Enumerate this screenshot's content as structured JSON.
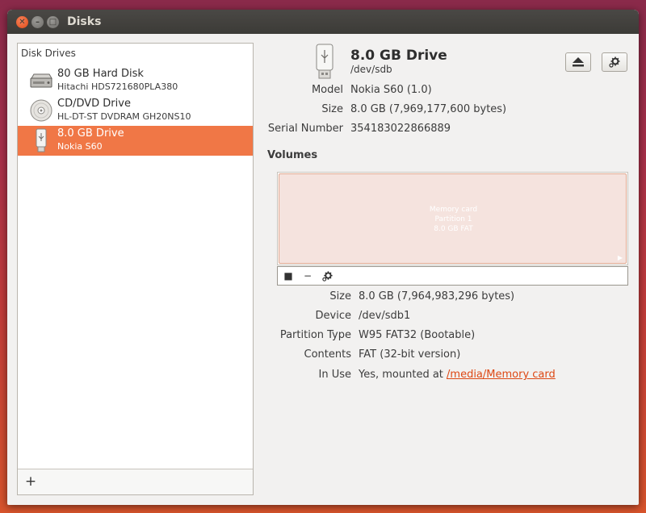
{
  "window": {
    "title": "Disks"
  },
  "sidebar": {
    "header": "Disk Drives",
    "drives": [
      {
        "name": "80 GB Hard Disk",
        "sub": "Hitachi HDS721680PLA380",
        "icon": "hard-disk-icon"
      },
      {
        "name": "CD/DVD Drive",
        "sub": "HL-DT-ST DVDRAM GH20NS10",
        "icon": "optical-disc-icon"
      },
      {
        "name": "8.0 GB Drive",
        "sub": "Nokia S60",
        "icon": "usb-drive-icon",
        "selected": true
      }
    ],
    "add_label": "+"
  },
  "drive": {
    "name": "8.0 GB Drive",
    "device": "/dev/sdb",
    "icon": "usb-drive-icon",
    "fields": [
      {
        "label": "Model",
        "value": "Nokia S60 (1.0)"
      },
      {
        "label": "Size",
        "value": "8.0 GB (7,969,177,600 bytes)"
      },
      {
        "label": "Serial Number",
        "value": "354183022866889"
      }
    ]
  },
  "volumes": {
    "title": "Volumes",
    "partition": {
      "line1": "Memory card",
      "line2": "Partition 1",
      "line3": "8.0 GB FAT"
    },
    "toolbar": [
      "■",
      "−"
    ],
    "fields": [
      {
        "label": "Size",
        "value": "8.0 GB (7,964,983,296 bytes)"
      },
      {
        "label": "Device",
        "value": "/dev/sdb1"
      },
      {
        "label": "Partition Type",
        "value": "W95 FAT32 (Bootable)"
      },
      {
        "label": "Contents",
        "value": "FAT (32-bit version)"
      },
      {
        "label": "In Use",
        "value_prefix": "Yes, mounted at ",
        "link": "/media/Memory card"
      }
    ]
  },
  "colors": {
    "accent": "#f07746",
    "link": "#dd4814",
    "titlebar": "#3c3b37"
  }
}
